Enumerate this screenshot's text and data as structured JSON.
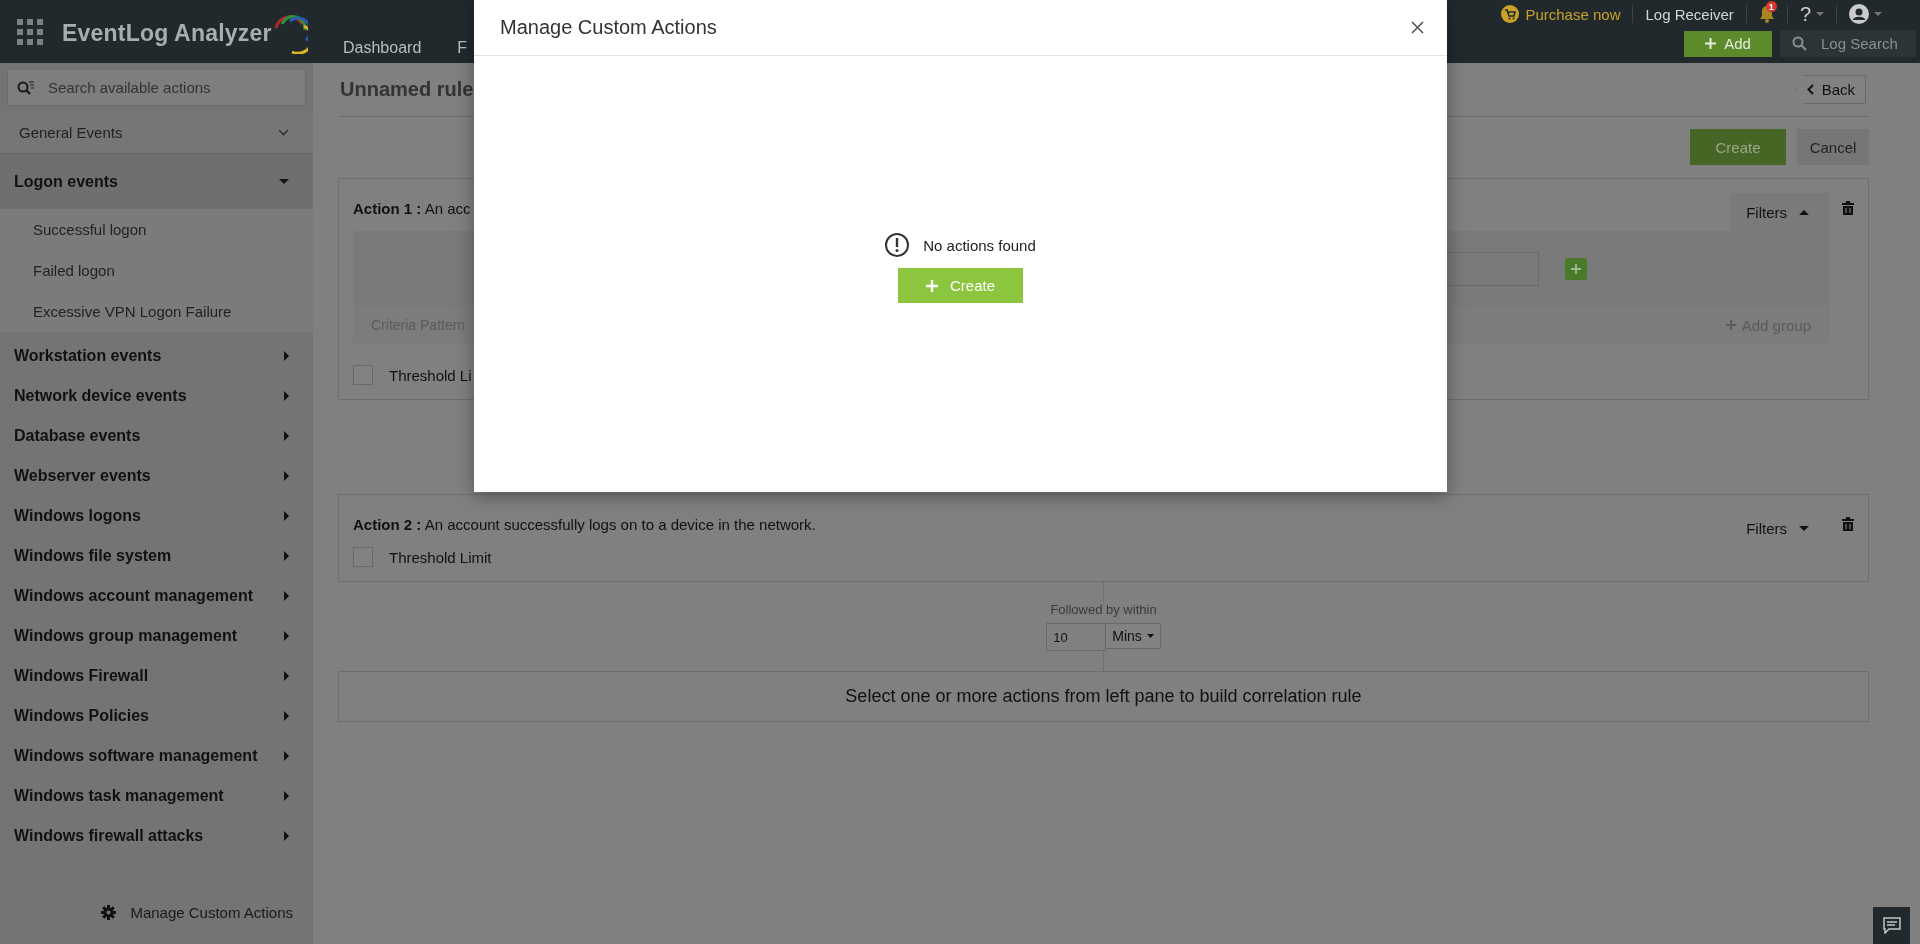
{
  "header": {
    "logo": "EventLog Analyzer",
    "nav": [
      {
        "label": "Dashboard"
      },
      {
        "label": "F"
      }
    ],
    "purchase": "Purchase now",
    "log_receiver": "Log Receiver",
    "notification_count": "1",
    "help": "?",
    "add": "Add",
    "log_search": {
      "placeholder": "Log Search"
    }
  },
  "sidebar": {
    "search": {
      "placeholder": "Search available actions"
    },
    "categories": [
      {
        "label": "General Events",
        "kind": "section",
        "expanded": true
      },
      {
        "label": "Logon events",
        "kind": "group",
        "expanded": true,
        "children": [
          {
            "label": "Successful logon"
          },
          {
            "label": "Failed logon"
          },
          {
            "label": "Excessive VPN Logon Failure"
          }
        ]
      },
      {
        "label": "Workstation events",
        "kind": "group",
        "expanded": false
      },
      {
        "label": "Network device events",
        "kind": "group",
        "expanded": false
      },
      {
        "label": "Database events",
        "kind": "group",
        "expanded": false
      },
      {
        "label": "Webserver events",
        "kind": "group",
        "expanded": false
      },
      {
        "label": "Windows logons",
        "kind": "group",
        "expanded": false
      },
      {
        "label": "Windows file system",
        "kind": "group",
        "expanded": false
      },
      {
        "label": "Windows account management",
        "kind": "group",
        "expanded": false
      },
      {
        "label": "Windows group management",
        "kind": "group",
        "expanded": false
      },
      {
        "label": "Windows Firewall",
        "kind": "group",
        "expanded": false
      },
      {
        "label": "Windows Policies",
        "kind": "group",
        "expanded": false
      },
      {
        "label": "Windows software management",
        "kind": "group",
        "expanded": false
      },
      {
        "label": "Windows task management",
        "kind": "group",
        "expanded": false
      },
      {
        "label": "Windows firewall attacks",
        "kind": "group",
        "expanded": false
      }
    ],
    "footer": "Manage Custom Actions"
  },
  "main": {
    "title": "Unnamed rule",
    "back": "Back",
    "create": "Create",
    "cancel": "Cancel",
    "actions": [
      {
        "title": "**Action 1 :** An acc",
        "filters": "Filters",
        "filters_expanded": true,
        "criteria": "Criteria Pattern",
        "add_group": "Add group",
        "threshold": "Threshold Li",
        "threshold_checked": false
      },
      {
        "title": "**Action 2 :** An account successfully logs on to a device in the network.",
        "filters": "Filters",
        "filters_expanded": false,
        "threshold": "Threshold Limit",
        "threshold_checked": false
      }
    ],
    "connector": {
      "label": "Followed by within",
      "value": "10",
      "unit": "Mins"
    },
    "hint": "Select one or more actions from left pane to build correlation rule"
  },
  "modal": {
    "title": "Manage Custom Actions",
    "message": "No actions found",
    "create": "Create"
  }
}
